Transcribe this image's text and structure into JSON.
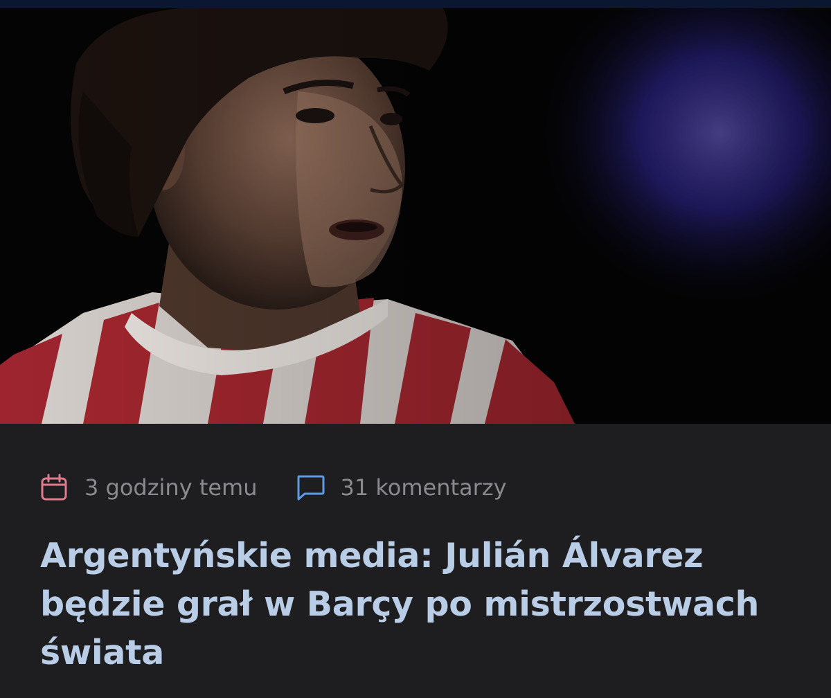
{
  "article": {
    "image_alt": "Julián Álvarez",
    "meta": {
      "date_icon": "calendar-icon",
      "date_text": "3 godziny temu",
      "comments_icon": "comment-icon",
      "comments_text": "31 komentarzy"
    },
    "title": "Argentyńskie media: Julián Álvarez będzie grał w Barçy po mistrzostwach świata"
  },
  "colors": {
    "background": "#1e1e20",
    "title": "#b9cde6",
    "meta_text": "#8a8a8f",
    "date_icon": "#e07a8c",
    "comments_icon": "#5d9be8",
    "topbar": "#0b1630"
  }
}
